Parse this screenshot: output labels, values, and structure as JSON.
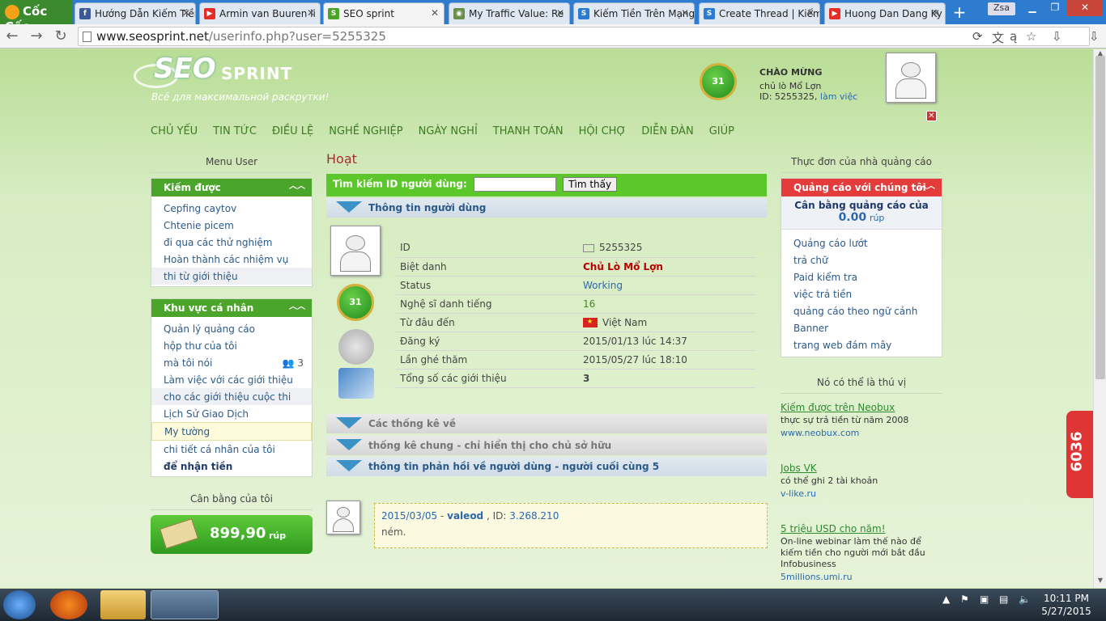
{
  "browser": {
    "logo": "Cốc Cốc",
    "tabs": [
      {
        "title": "Hướng Dẫn Kiếm Tiền",
        "icon_color": "#3b5998",
        "icon": "f"
      },
      {
        "title": "Armin van Buuren li",
        "icon_color": "#e52d27",
        "icon": "▶"
      },
      {
        "title": "SEO sprint",
        "icon_color": "#4ba52b",
        "icon": "S",
        "active": true
      },
      {
        "title": "My Traffic Value: Re",
        "icon_color": "#6a8f4a",
        "icon": "◉"
      },
      {
        "title": "Kiếm Tiền Trên Mạng",
        "icon_color": "#2b7bd0",
        "icon": "S"
      },
      {
        "title": "Create Thread | Kiếm",
        "icon_color": "#2b7bd0",
        "icon": "S"
      },
      {
        "title": "Huong Dan Dang Ky",
        "icon_color": "#e52d27",
        "icon": "▶"
      }
    ],
    "user_label": "Zsa",
    "url_domain": "www.seosprint.net",
    "url_path": "/userinfo.php?user=5255325"
  },
  "header": {
    "logo_seo": "SEO",
    "logo_sprint": "SPRINT",
    "slogan": "Всё для максимальной раскрутки!",
    "level": "31",
    "greeting": "CHÀO MỪNG",
    "username": "chủ lò Mổ Lợn",
    "id_label": "ID: 5255325,",
    "id_link": "làm việc",
    "close": "✕"
  },
  "nav": [
    "CHỦ YẾU",
    "TIN TỨC",
    "ĐIỀU LỆ",
    "NGHỀ NGHIỆP",
    "NGÀY NGHỈ",
    "THANH TOÁN",
    "HỘI CHỢ",
    "DIỄN ĐÀN",
    "GIÚP"
  ],
  "left": {
    "title": "Menu User",
    "earn_title": "Kiếm được",
    "earn_items": [
      "Cepfing caytov",
      "Chtenie picem",
      "đi qua các thử nghiệm",
      "Hoàn thành các nhiệm vụ",
      "thi từ giới thiệu"
    ],
    "personal_title": "Khu vực cá nhân",
    "personal_items": [
      "Quản lý quảng cáo",
      "hộp thư của tôi",
      "mà tôi nói",
      "Làm việc với các giới thiệu",
      "cho các giới thiệu cuộc thi",
      "Lịch Sử Giao Dịch",
      "My tường",
      "chi tiết cá nhân của tôi",
      "để nhận tiền"
    ],
    "mention_count": "3",
    "balance_title": "Cân bằng của tôi",
    "balance_amount": "899,90",
    "balance_unit": "rúp"
  },
  "center": {
    "title": "Hoạt",
    "search_label": "Tìm kiếm ID người dùng:",
    "search_value": "",
    "search_button": "Tìm thấy",
    "user_info_title": "Thông tin người dùng",
    "level": "31",
    "rows": [
      {
        "label": "ID",
        "value": "5255325"
      },
      {
        "label": "Biệt danh",
        "value": "Chủ Lò Mổ Lợn"
      },
      {
        "label": "Status",
        "value": "Working"
      },
      {
        "label": "Nghệ sĩ danh tiếng",
        "value": "16"
      },
      {
        "label": "Từ đâu đến",
        "value": "Việt Nam"
      },
      {
        "label": "Đăng ký",
        "value": "2015/01/13 lúc 14:37"
      },
      {
        "label": "Lần ghé thăm",
        "value": "2015/05/27 lúc 18:10"
      },
      {
        "label": "Tổng số các giới thiệu",
        "value": "3"
      }
    ],
    "stats_title": "Các thống kê về",
    "stats_owner_title": "thống kê chung - chỉ hiển thị cho chủ sở hữu",
    "feedback_title": "thông tin phản hồi về người dùng - người cuối cùng 5",
    "comment": {
      "date": "2015/03/05",
      "sep": " - ",
      "name": "valeod",
      "id_label": " , ID: ",
      "id": "3.268.210",
      "text": "ném."
    }
  },
  "right": {
    "title": "Thực đơn của nhà quảng cáo",
    "ads_title": "Quảng cáo với chúng tôi",
    "ad_balance_label": "Cân bằng quảng cáo của",
    "ad_balance_value": "0.00",
    "ad_balance_unit": "rúp",
    "ad_items": [
      "Quảng cáo lướt",
      "trả chữ",
      "Paid kiểm tra",
      "việc trả tiền",
      "quảng cáo theo ngữ cảnh",
      "Banner",
      "trang web đám mây"
    ],
    "interest_title": "Nó có thể là thú vị",
    "sponsors": [
      {
        "title": "Kiếm được trên Neobux",
        "desc": "thực sự trả tiền từ năm 2008",
        "url": "www.neobux.com"
      },
      {
        "title": "Jobs VK",
        "desc": "có thể ghi 2 tài khoản",
        "url": "v-like.ru"
      },
      {
        "title": "5 triệu USD cho năm!",
        "desc": "On-line webinar làm thế nào để kiếm tiền cho người mới bắt đầu Infobusiness",
        "url": "5millions.umi.ru"
      }
    ]
  },
  "side_counter": "6036",
  "taskbar": {
    "time": "10:11 PM",
    "date": "5/27/2015"
  }
}
